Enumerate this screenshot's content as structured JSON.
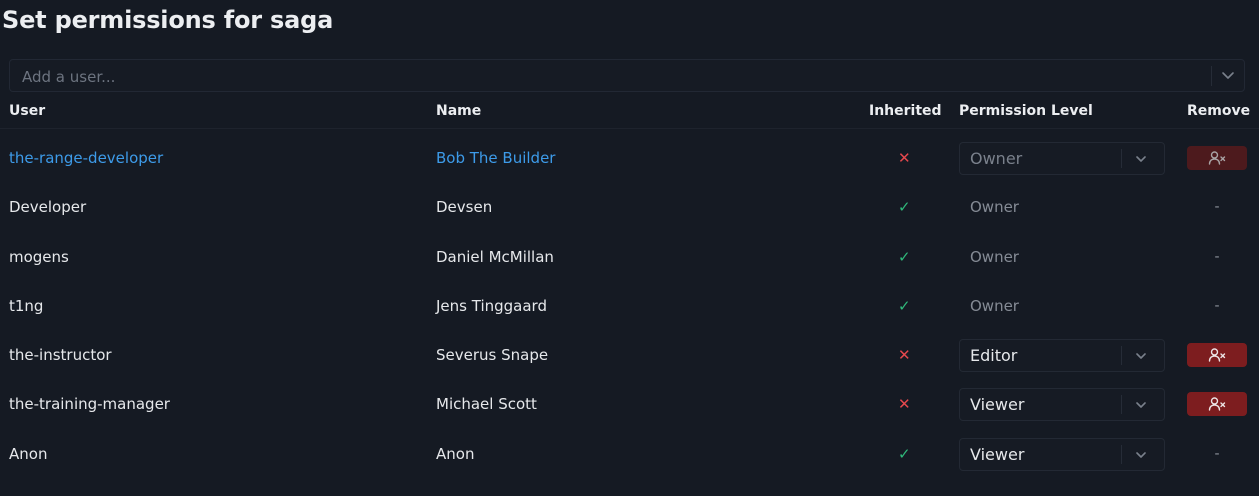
{
  "page": {
    "title": "Set permissions for saga"
  },
  "add_user": {
    "placeholder": "Add a user..."
  },
  "headers": {
    "user": "User",
    "name": "Name",
    "inherited": "Inherited",
    "permission_level": "Permission Level",
    "remove": "Remove"
  },
  "rows": [
    {
      "user": "the-range-developer",
      "name": "Bob The Builder",
      "inherited": false,
      "inherited_symbol": "✕",
      "level": "Owner",
      "level_editable": true,
      "select_disabled": true,
      "remove": "button",
      "remove_disabled": true,
      "highlight": true
    },
    {
      "user": "Developer",
      "name": "Devsen",
      "inherited": true,
      "inherited_symbol": "✓",
      "level": "Owner",
      "level_editable": false,
      "remove": "-"
    },
    {
      "user": "mogens",
      "name": "Daniel McMillan",
      "inherited": true,
      "inherited_symbol": "✓",
      "level": "Owner",
      "level_editable": false,
      "remove": "-"
    },
    {
      "user": "t1ng",
      "name": "Jens Tinggaard",
      "inherited": true,
      "inherited_symbol": "✓",
      "level": "Owner",
      "level_editable": false,
      "remove": "-"
    },
    {
      "user": "the-instructor",
      "name": "Severus Snape",
      "inherited": false,
      "inherited_symbol": "✕",
      "level": "Editor",
      "level_editable": true,
      "select_disabled": false,
      "remove": "button",
      "remove_disabled": false
    },
    {
      "user": "the-training-manager",
      "name": "Michael Scott",
      "inherited": false,
      "inherited_symbol": "✕",
      "level": "Viewer",
      "level_editable": true,
      "select_disabled": false,
      "remove": "button",
      "remove_disabled": false
    },
    {
      "user": "Anon",
      "name": "Anon",
      "inherited": true,
      "inherited_symbol": "✓",
      "level": "Viewer",
      "level_editable": true,
      "select_disabled": false,
      "remove": "-"
    }
  ],
  "colors": {
    "background": "#151a23",
    "link": "#3d9be9",
    "check": "#2fb87a",
    "cross": "#e5484d",
    "remove_button": "#7d1d1f"
  },
  "icons": {
    "dropdown": "chevron-down-icon",
    "remove": "user-remove-icon",
    "inherited_yes": "check-icon",
    "inherited_no": "x-icon"
  }
}
